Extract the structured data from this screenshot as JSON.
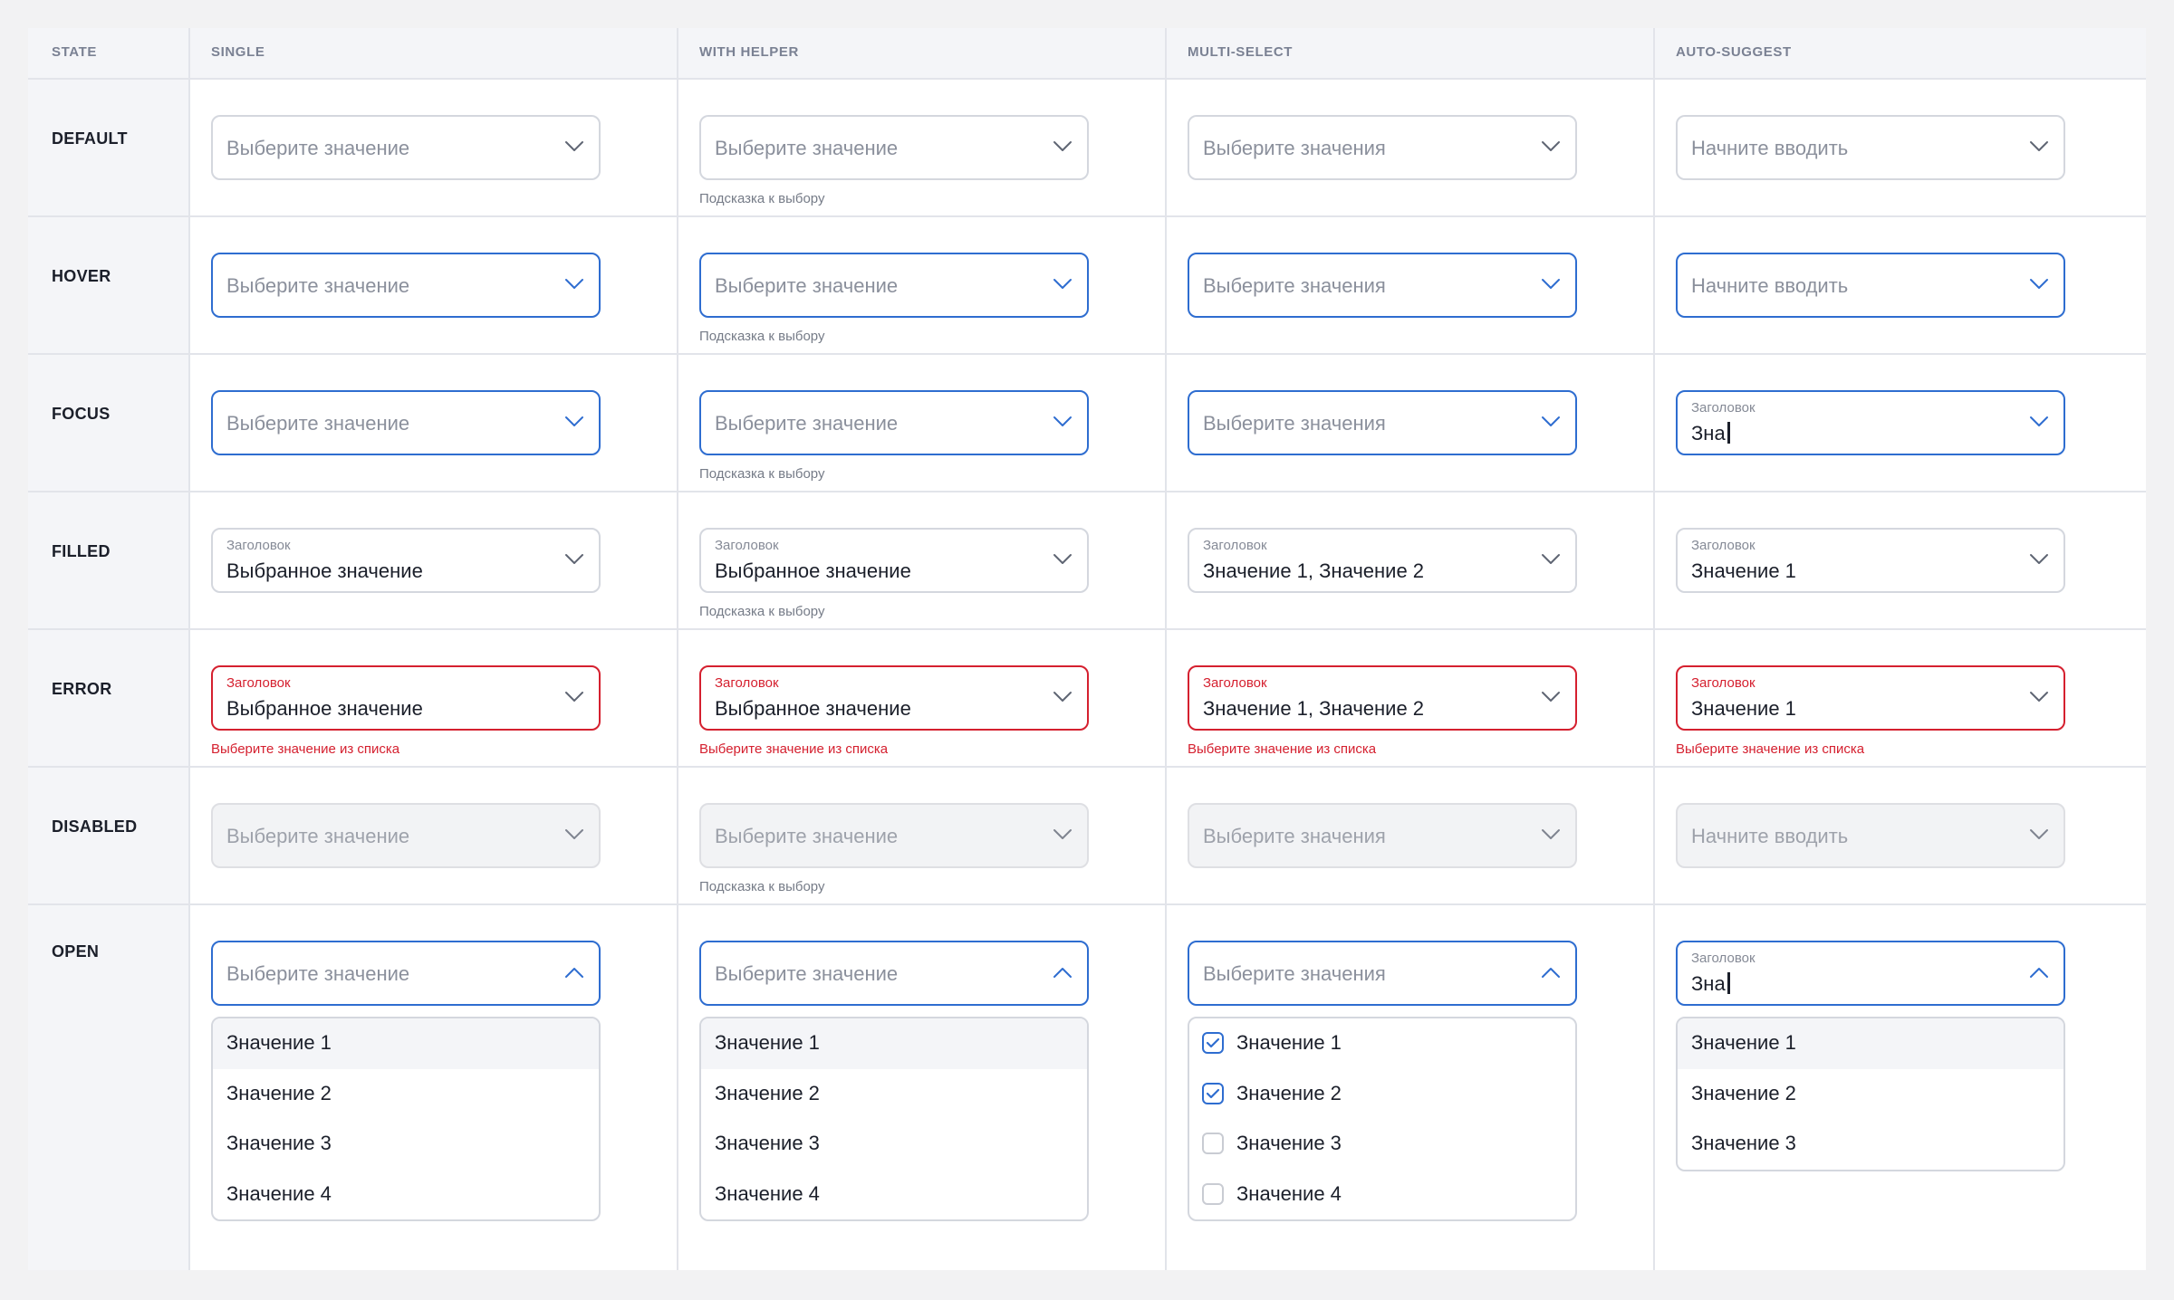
{
  "columns": [
    "STATE",
    "SINGLE",
    "WITH HELPER",
    "MULTI-SELECT",
    "AUTO-SUGGEST"
  ],
  "rows": [
    "DEFAULT",
    "HOVER",
    "FOCUS",
    "FILLED",
    "ERROR",
    "DISABLED",
    "OPEN"
  ],
  "placeholders": {
    "single": "Выберите значение",
    "multi": "Выберите значения",
    "auto": "Начните вводить"
  },
  "label": "Заголовок",
  "helper": "Подсказка к выбору",
  "error_message": "Выберите значение из списка",
  "typed_text": "Зна",
  "filled_values": {
    "single": "Выбранное значение",
    "with_helper": "Выбранное значение",
    "multi": "Значение 1, Значение 2",
    "auto": "Значение 1"
  },
  "options": [
    "Значение 1",
    "Значение 2",
    "Значение 3",
    "Значение 4"
  ],
  "auto_options": [
    "Значение 1",
    "Значение 2",
    "Значение 3"
  ],
  "multi_checked": [
    true,
    true,
    false,
    false
  ],
  "icons": {
    "closed": "chevron-down-icon",
    "open": "chevron-up-icon",
    "check": "check-icon"
  },
  "colors": {
    "accent": "#2e6dd0",
    "error": "#d5202f",
    "border": "#d4d7de",
    "disabled_bg": "#f2f3f5",
    "header_bg": "#f4f5f8"
  }
}
